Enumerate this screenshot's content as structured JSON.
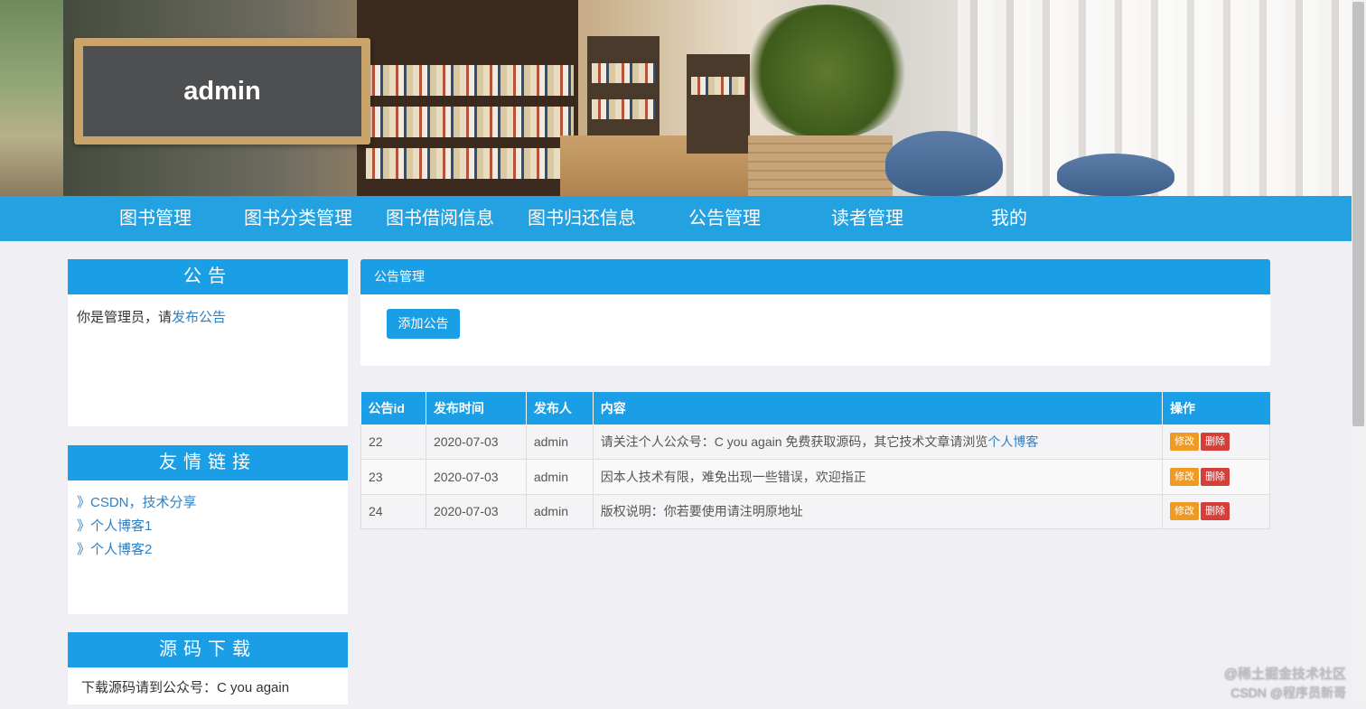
{
  "header": {
    "title": "admin"
  },
  "nav": {
    "items": [
      {
        "label": "图书管理"
      },
      {
        "label": "图书分类管理"
      },
      {
        "label": "图书借阅信息"
      },
      {
        "label": "图书归还信息"
      },
      {
        "label": "公告管理"
      },
      {
        "label": "读者管理"
      },
      {
        "label": "我的"
      }
    ]
  },
  "sidebar": {
    "notice": {
      "title": "公告",
      "text": "你是管理员，请",
      "link": "发布公告"
    },
    "friends": {
      "title": "友情链接",
      "items": [
        "》CSDN，技术分享",
        "》个人博客1",
        "》个人博客2"
      ]
    },
    "download": {
      "title": "源码下载",
      "text": "下载源码请到公众号：C you again"
    }
  },
  "main": {
    "panel_title": "公告管理",
    "add_button": "添加公告",
    "table": {
      "headers": [
        "公告id",
        "发布时间",
        "发布人",
        "内容",
        "操作"
      ],
      "rows": [
        {
          "id": "22",
          "date": "2020-07-03",
          "author": "admin",
          "content": "请关注个人公众号：C you again 免费获取源码，其它技术文章请浏览",
          "content_link": "个人博客"
        },
        {
          "id": "23",
          "date": "2020-07-03",
          "author": "admin",
          "content": "因本人技术有限，难免出现一些错误，欢迎指正",
          "content_link": ""
        },
        {
          "id": "24",
          "date": "2020-07-03",
          "author": "admin",
          "content": "版权说明：你若要使用请注明原地址",
          "content_link": ""
        }
      ],
      "edit_label": "修改",
      "delete_label": "删除"
    }
  },
  "watermark": {
    "line1": "@稀土掘金技术社区",
    "line2": "CSDN @程序员新哥"
  }
}
